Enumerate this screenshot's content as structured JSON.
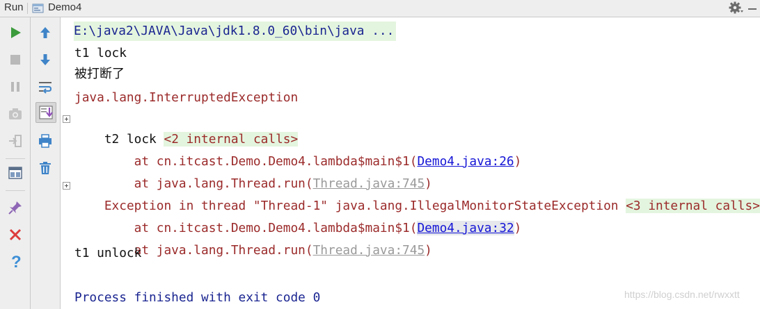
{
  "header": {
    "run_label": "Run",
    "tab_label": "Demo4",
    "icons": [
      "run-config-icon",
      "gear-icon",
      "minimize-icon"
    ]
  },
  "toolbar_left": [
    "rerun-icon",
    "stop-icon",
    "pause-icon",
    "dump-threads-icon",
    "exit-icon",
    "layout-icon",
    "pin-icon",
    "close-icon",
    "help-icon"
  ],
  "toolbar_right": [
    "up-arrow-icon",
    "down-arrow-icon",
    "soft-wrap-icon",
    "scroll-to-end-icon",
    "print-icon",
    "trash-icon"
  ],
  "console": {
    "cmd": "E:\\java2\\JAVA\\Java\\jdk1.8.0_60\\bin\\java ...",
    "line_t1_lock": "t1 lock",
    "line_interrupted": "被打断了",
    "line_exception": "java.lang.InterruptedException",
    "line_t2_prefix": "t2 lock ",
    "line_t2_internal": "<2 internal calls>",
    "trace1_prefix": "    at cn.itcast.Demo.Demo4.lambda$main$1(",
    "trace1_link": "Demo4.java:26",
    "trace1_suffix": ")",
    "trace2_prefix": "    at java.lang.Thread.run(",
    "trace2_link": "Thread.java:745",
    "trace2_suffix": ")",
    "line_exc_thread": "Exception in thread \"Thread-1\" java.lang.IllegalMonitorStateException ",
    "line_exc_internal": "<3 internal calls>",
    "trace3_prefix": "    at cn.itcast.Demo.Demo4.lambda$main$1(",
    "trace3_link": "Demo4.java:32",
    "trace3_suffix": ")",
    "trace4_prefix": "    at java.lang.Thread.run(",
    "trace4_link": "Thread.java:745",
    "trace4_suffix": ")",
    "line_t1_unlock": "t1 unlock",
    "line_process": "Process finished with exit code 0"
  },
  "watermark": "https://blog.csdn.net/rwxxtt"
}
